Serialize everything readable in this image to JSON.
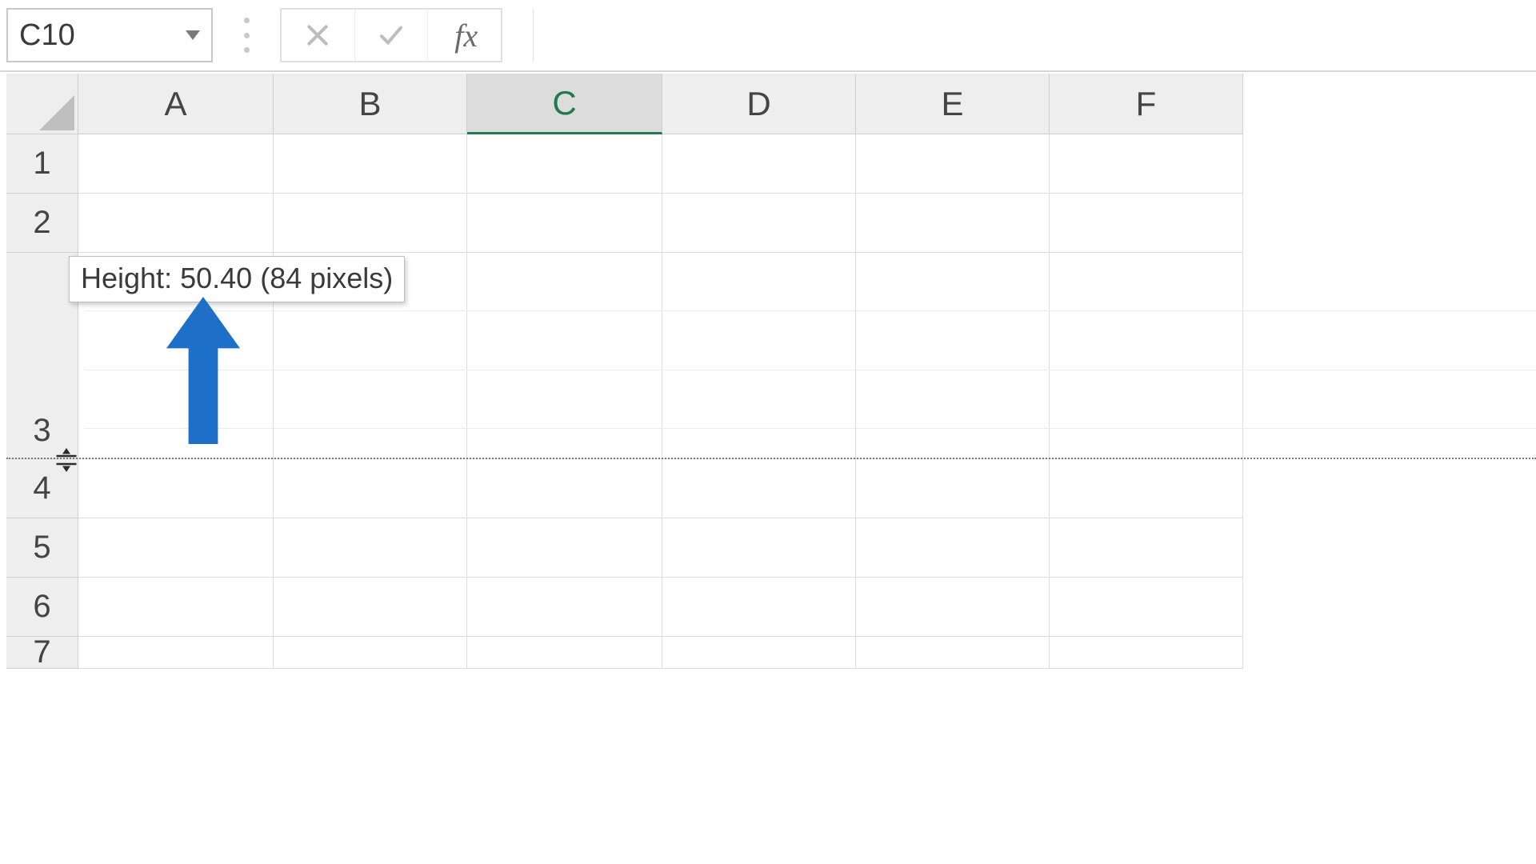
{
  "formula_bar": {
    "name_box_value": "C10",
    "cancel_label": "✕",
    "confirm_label": "✓",
    "fx_label": "fx",
    "formula_value": ""
  },
  "columns": [
    "A",
    "B",
    "C",
    "D",
    "E",
    "F"
  ],
  "selected_column": "C",
  "rows": [
    "1",
    "2",
    "3",
    "4",
    "5",
    "6",
    "7"
  ],
  "resize_tooltip": {
    "label": "Height:",
    "points": "50.40",
    "pixels": "(84 pixels)"
  },
  "colors": {
    "accent_green": "#1f7b4d",
    "arrow_blue": "#1e6fc8",
    "header_bg": "#eeeeee"
  }
}
